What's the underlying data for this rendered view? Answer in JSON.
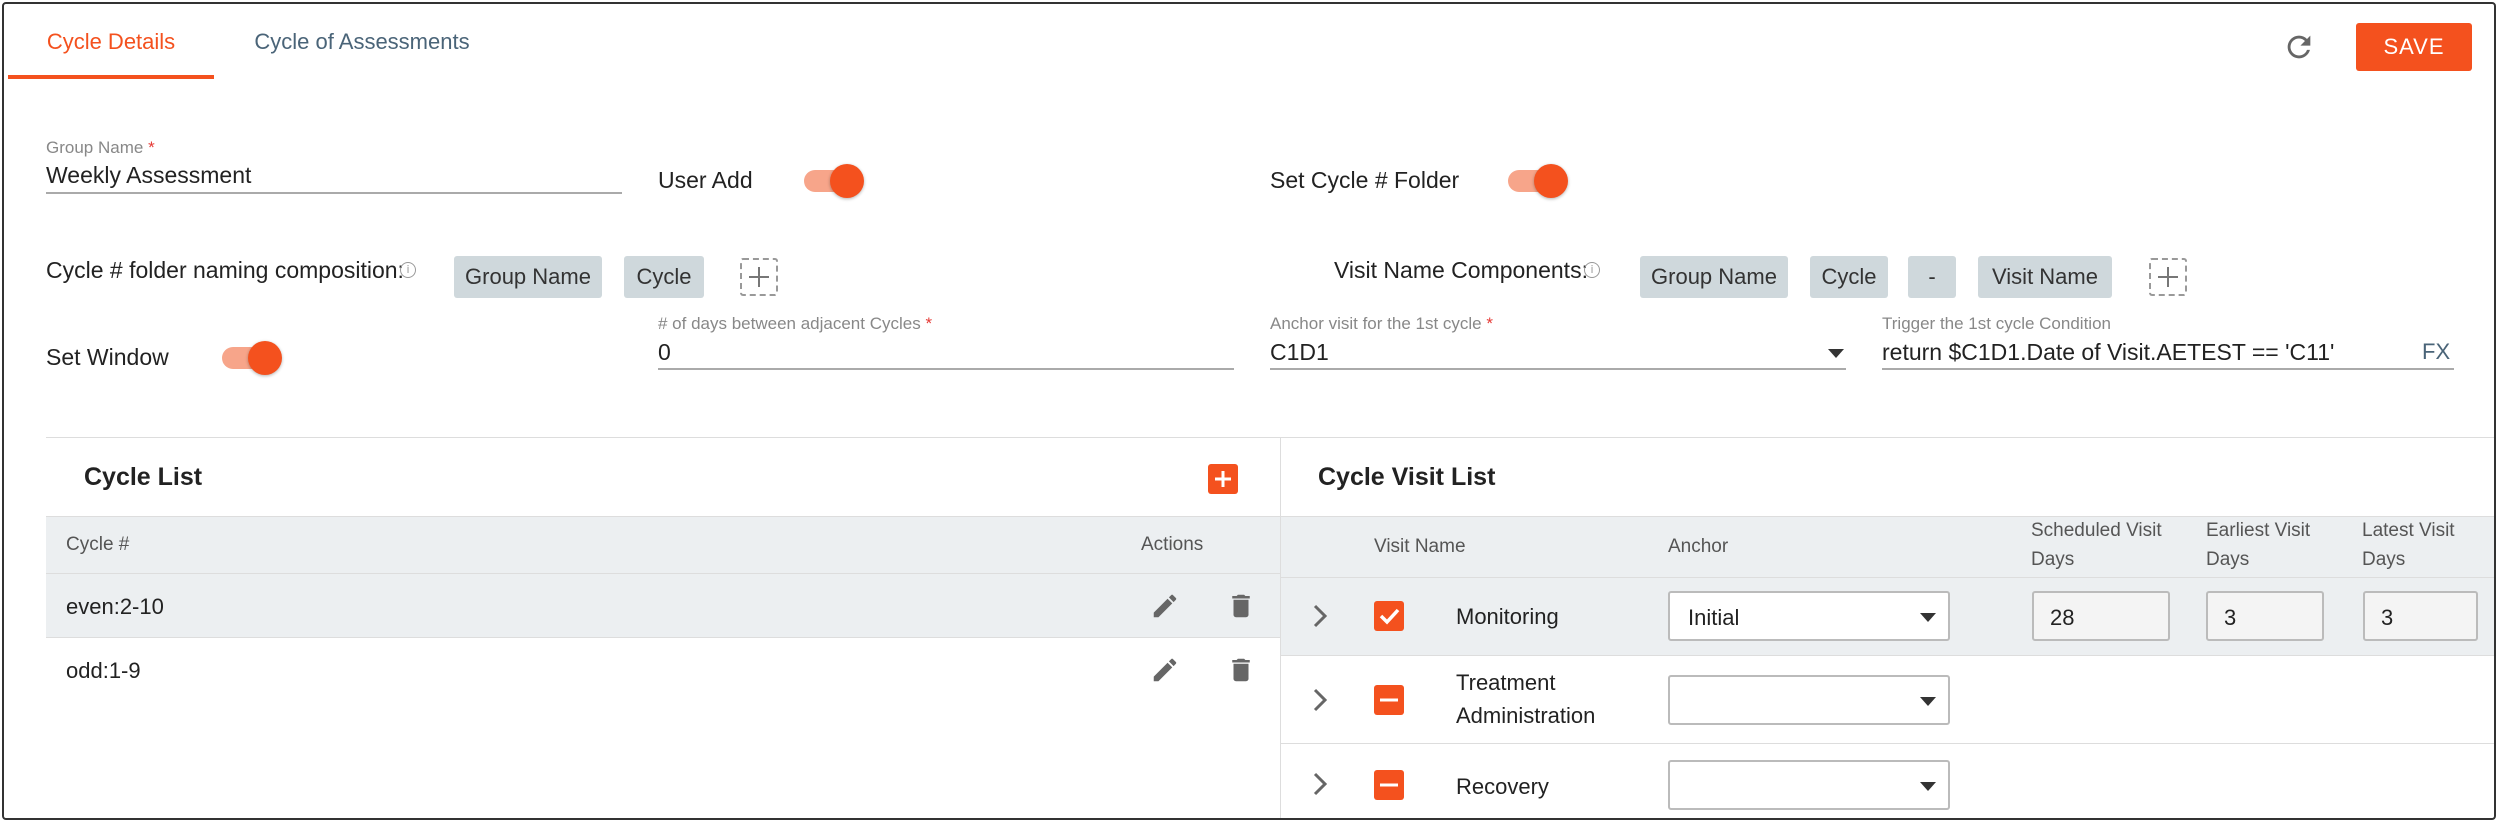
{
  "tabs": [
    {
      "label": "Cycle Details"
    },
    {
      "label": "Cycle of Assessments"
    }
  ],
  "header": {
    "save_label": "SAVE"
  },
  "form": {
    "group_name_label": "Group Name",
    "group_name_required": "*",
    "group_name_value": "Weekly Assessment",
    "user_add_label": "User Add",
    "user_add_on": true,
    "set_cycle_folder_label": "Set Cycle # Folder",
    "set_cycle_folder_on": true,
    "folder_naming_label": "Cycle # folder naming composition:",
    "folder_chips": [
      "Group Name",
      "Cycle"
    ],
    "visit_name_label": "Visit Name Components:",
    "visit_chips": [
      "Group Name",
      "Cycle",
      "-",
      "Visit Name"
    ],
    "set_window_label": "Set Window",
    "set_window_on": true,
    "days_between_label": "# of days between adjacent Cycles",
    "days_between_required": "*",
    "days_between_value": "0",
    "anchor_label": "Anchor visit for the 1st cycle",
    "anchor_required": "*",
    "anchor_value": "C1D1",
    "trigger_label": "Trigger the 1st cycle Condition",
    "trigger_value": "return $C1D1.Date of Visit.AETEST == 'C11'",
    "fx_label": "FX",
    "info_glyph": "i"
  },
  "cycle_list": {
    "title": "Cycle List",
    "col_cycle": "Cycle #",
    "col_actions": "Actions",
    "rows": [
      {
        "cycle": "even:2-10"
      },
      {
        "cycle": "odd:1-9"
      }
    ]
  },
  "visit_list": {
    "title": "Cycle Visit List",
    "col_visit_name": "Visit Name",
    "col_anchor": "Anchor",
    "col_scheduled_1": "Scheduled Visit",
    "col_scheduled_2": "Days",
    "col_earliest_1": "Earliest Visit",
    "col_earliest_2": "Days",
    "col_latest_1": "Latest Visit",
    "col_latest_2": "Days",
    "rows": [
      {
        "name": "Monitoring",
        "name2": "",
        "state": "checked",
        "anchor": "Initial",
        "scheduled": "28",
        "earliest": "3",
        "latest": "3"
      },
      {
        "name": "Treatment",
        "name2": "Administration",
        "state": "indeterminate",
        "anchor": "",
        "scheduled": "",
        "earliest": "",
        "latest": ""
      },
      {
        "name": "Recovery",
        "name2": "",
        "state": "indeterminate",
        "anchor": "",
        "scheduled": "",
        "earliest": "",
        "latest": ""
      }
    ]
  },
  "colors": {
    "accent": "#f4511e",
    "tab_inactive": "#4a6478",
    "chip_bg": "#cfd8dc"
  }
}
